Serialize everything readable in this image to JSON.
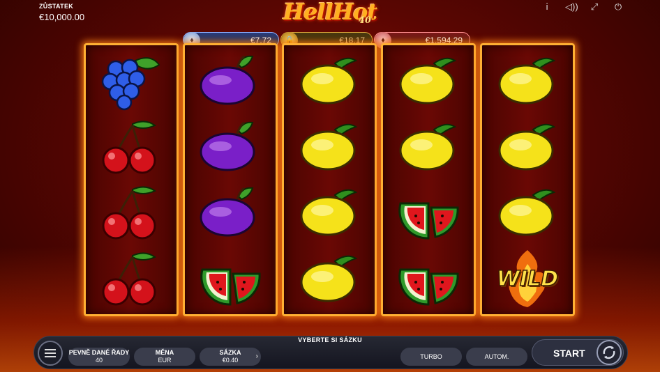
{
  "balance": {
    "label": "ZŮSTATEK",
    "value": "€10,000.00"
  },
  "logo": {
    "word": "HellHot",
    "number": "40"
  },
  "top_icons": [
    "info-icon",
    "sound-icon",
    "fullscreen-icon",
    "power-icon"
  ],
  "jackpots": [
    {
      "value": "€7.72",
      "tier": "blue"
    },
    {
      "value": "€18.17",
      "tier": "gold",
      "locked": true
    },
    {
      "value": "€1,594.29",
      "tier": "red"
    }
  ],
  "reels": [
    [
      "grapes",
      "cherry",
      "cherry",
      "cherry"
    ],
    [
      "plum",
      "plum",
      "plum",
      "watermelon"
    ],
    [
      "lemon",
      "lemon",
      "lemon",
      "lemon"
    ],
    [
      "lemon",
      "lemon",
      "watermelon",
      "watermelon"
    ],
    [
      "lemon",
      "lemon",
      "lemon",
      "wild"
    ]
  ],
  "wild_text": "WILD",
  "controls": {
    "bet_title": "VYBERTE SI SÁZKU",
    "lines_label": "PEVNĚ DANÉ ŘADY",
    "lines_value": "40",
    "currency_label": "MĚNA",
    "currency_value": "EUR",
    "bet_label": "SÁZKA",
    "bet_value": "€0.40",
    "turbo_label": "TURBO",
    "auto_label": "AUTOM.",
    "start_label": "START"
  }
}
